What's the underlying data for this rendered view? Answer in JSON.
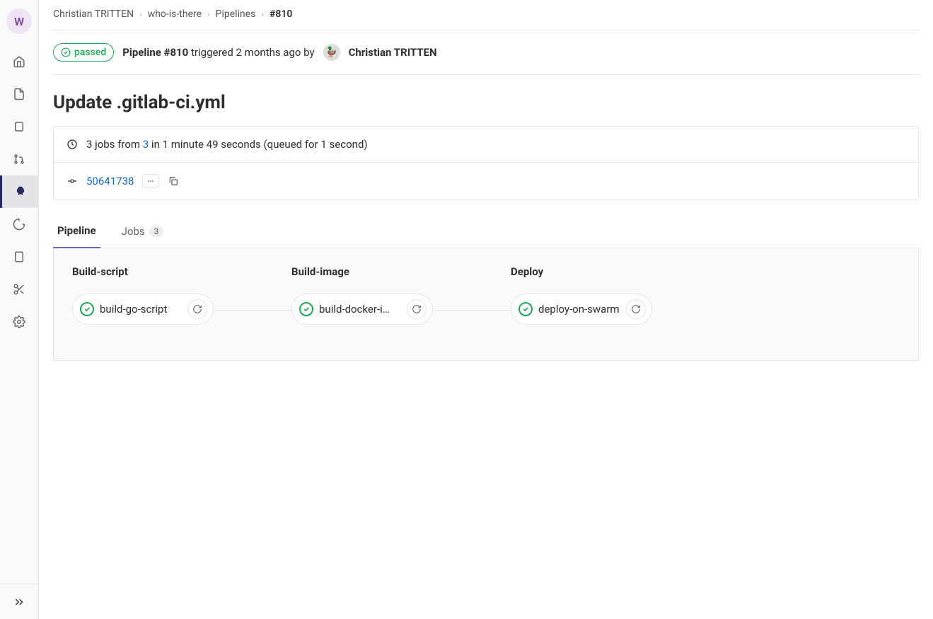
{
  "sidebar": {
    "avatar_letter": "W"
  },
  "breadcrumb": {
    "items": [
      "Christian TRITTEN",
      "who-is-there",
      "Pipelines"
    ],
    "current": "#810"
  },
  "header": {
    "status": "passed",
    "pipeline_label": "Pipeline #810",
    "triggered_text": " triggered 2 months ago by ",
    "author": "Christian TRITTEN"
  },
  "title": "Update .gitlab-ci.yml",
  "info": {
    "jobs_prefix": "3 jobs from ",
    "jobs_link": "3",
    "jobs_suffix": " in 1 minute 49 seconds (queued for 1 second)",
    "commit": "50641738"
  },
  "tabs": {
    "pipeline": "Pipeline",
    "jobs": "Jobs",
    "jobs_count": "3"
  },
  "stages": [
    {
      "name": "Build-script",
      "job": "build-go-script"
    },
    {
      "name": "Build-image",
      "job": "build-docker-i…"
    },
    {
      "name": "Deploy",
      "job": "deploy-on-swarm"
    }
  ]
}
